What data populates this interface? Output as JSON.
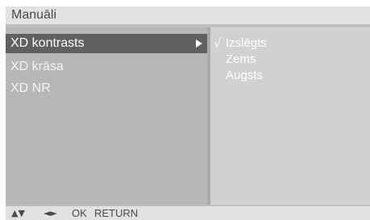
{
  "title": "Manuāli",
  "menu": {
    "items": [
      {
        "label": "XD kontrasts",
        "selected": true
      },
      {
        "label": "XD krāsa",
        "selected": false
      },
      {
        "label": "XD NR",
        "selected": false
      }
    ]
  },
  "options": {
    "checkmark": "√",
    "items": [
      {
        "label": "Izslēgts",
        "checked": true
      },
      {
        "label": "Zems",
        "checked": false
      },
      {
        "label": "Augsts",
        "checked": false
      }
    ]
  },
  "footer": {
    "up_down": "▲▼",
    "left_right": "◄►",
    "ok": "OK",
    "return": "RETURN"
  },
  "colors": {
    "selected_item_bg": "#606060",
    "panel_bg": "#b7b7b7",
    "options_bg": "#d1d1d1",
    "title_bar_bg": "#e2e2e2"
  }
}
